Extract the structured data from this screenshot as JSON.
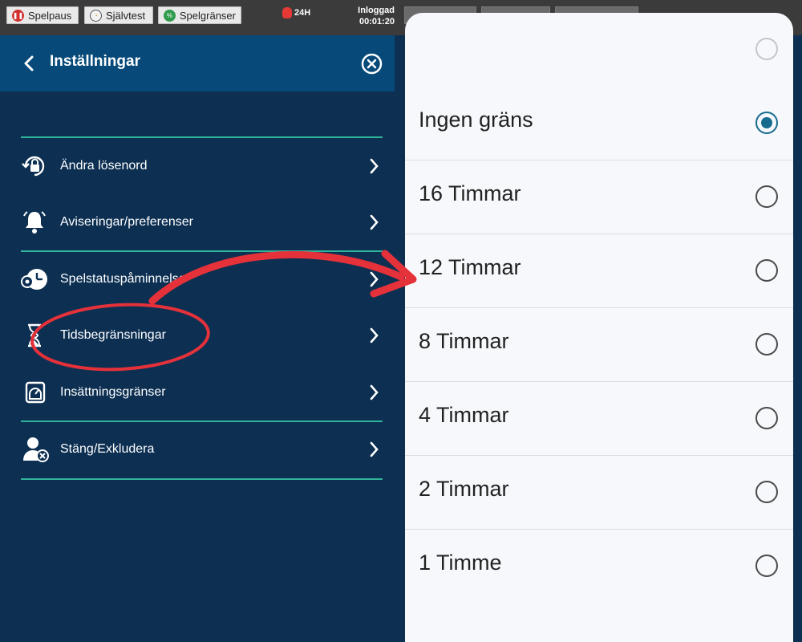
{
  "topbar": {
    "buttons": [
      {
        "label": "Spelpaus",
        "icon": "pause-icon",
        "color": "#d32f2f"
      },
      {
        "label": "Självtest",
        "icon": "gauge-icon",
        "color": "#c9a227"
      },
      {
        "label": "Spelgränser",
        "icon": "limits-icon",
        "color": "#2e9c4a"
      }
    ],
    "badge_24h": "24H",
    "login_label": "Inloggad",
    "login_time": "00:01:20"
  },
  "settings": {
    "title": "Inställningar",
    "items": [
      {
        "label": "Ändra lösenord",
        "icon": "lock-refresh-icon"
      },
      {
        "label": "Aviseringar/preferenser",
        "icon": "bell-icon"
      },
      {
        "label": "Spelstatuspåminnelse",
        "icon": "clock-reminder-icon"
      },
      {
        "label": "Tidsbegränsningar",
        "icon": "hourglass-icon"
      },
      {
        "label": "Insättningsgränser",
        "icon": "deposit-limit-icon"
      },
      {
        "label": "Stäng/Exkludera",
        "icon": "user-exclude-icon"
      }
    ]
  },
  "time_limit_sheet": {
    "options": [
      {
        "label": "Ingen gräns",
        "selected": true
      },
      {
        "label": "16 Timmar",
        "selected": false
      },
      {
        "label": "12 Timmar",
        "selected": false
      },
      {
        "label": "8 Timmar",
        "selected": false
      },
      {
        "label": "4 Timmar",
        "selected": false
      },
      {
        "label": "2 Timmar",
        "selected": false
      },
      {
        "label": "1 Timme",
        "selected": false
      }
    ]
  },
  "colors": {
    "accent_divider": "#2fb49a",
    "header_bg": "#074a7a",
    "panel_bg": "#0c2f52",
    "radio_selected": "#176b8f",
    "annotation_red": "#e5313a"
  }
}
